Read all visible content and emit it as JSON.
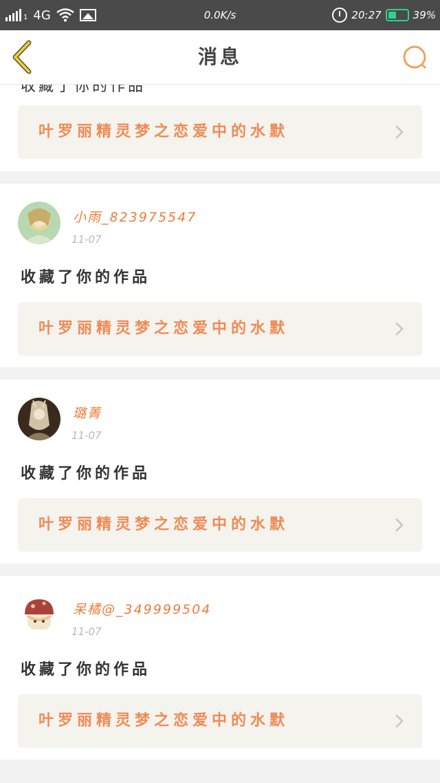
{
  "status_bar": {
    "network": "4G",
    "signal_sub": "1",
    "speed": "0.0K/s",
    "time": "20:27",
    "battery": "39%",
    "battery_level": 0.39,
    "battery_color": "#2fd190"
  },
  "nav": {
    "title": "消息",
    "back_icon": "chevron-left-icon",
    "search_icon": "search-icon",
    "accent_color": "#f0a35a"
  },
  "feed": {
    "partial_card": {
      "action": "收藏了你的作品",
      "work_title": "叶罗丽精灵梦之恋爱中的水默"
    },
    "items": [
      {
        "username": "小雨_823975547",
        "date": "11-07",
        "action": "收藏了你的作品",
        "work_title": "叶罗丽精灵梦之恋爱中的水默"
      },
      {
        "username": "璐菁",
        "date": "11-07",
        "action": "收藏了你的作品",
        "work_title": "叶罗丽精灵梦之恋爱中的水默"
      },
      {
        "username": "呆橘@_349999504",
        "date": "11-07",
        "action": "收藏了你的作品",
        "work_title": "叶罗丽精灵梦之恋爱中的水默"
      }
    ]
  },
  "colors": {
    "username": "#f07a3a",
    "work_title": "#f08a54",
    "date": "#b8b8b8",
    "link_bg": "#f4f3ee"
  }
}
